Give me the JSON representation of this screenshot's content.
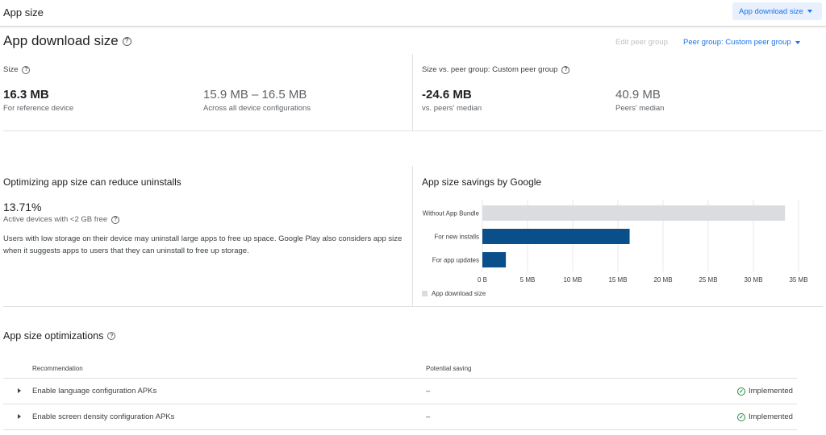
{
  "header": {
    "title": "App size",
    "dropdown_label": "App download size"
  },
  "download_size": {
    "title": "App download size",
    "edit_peer_group": "Edit peer group",
    "peer_group_dropdown": "Peer group: Custom peer group",
    "size": {
      "label": "Size",
      "reference_value": "16.3 MB",
      "reference_caption": "For reference device",
      "range_value": "15.9 MB – 16.5 MB",
      "range_caption": "Across all device configurations"
    },
    "peer": {
      "label": "Size vs. peer group: Custom peer group",
      "diff_value": "-24.6 MB",
      "diff_caption": "vs. peers' median",
      "median_value": "40.9 MB",
      "median_caption": "Peers' median"
    }
  },
  "optimizing": {
    "title": "Optimizing app size can reduce uninstalls",
    "percent": "13.71%",
    "percent_caption": "Active devices with <2 GB free",
    "description_line1": "Users with low storage on their device may uninstall large apps to free up space. Google Play also considers app size",
    "description_line2": "when it suggests apps to users that they can uninstall to free up storage."
  },
  "savings": {
    "title": "App size savings by Google"
  },
  "chart_data": {
    "type": "bar",
    "orientation": "horizontal",
    "categories": [
      "Without App Bundle",
      "For new installs",
      "For app updates"
    ],
    "values": [
      33.5,
      16.3,
      2.6
    ],
    "bar_colors": [
      "#dadce0",
      "#0b4f8a",
      "#0b4f8a"
    ],
    "x_ticks": [
      "0 B",
      "5 MB",
      "10 MB",
      "15 MB",
      "20 MB",
      "25 MB",
      "30 MB",
      "35 MB"
    ],
    "xlim": [
      0,
      35
    ],
    "unit": "MB",
    "legend": "App download size",
    "legend_position": "bottom-left",
    "grid": true
  },
  "optimizations": {
    "title": "App size optimizations",
    "columns": [
      "Recommendation",
      "Potential saving"
    ],
    "rows": [
      {
        "recommendation": "Enable language configuration APKs",
        "saving": "–",
        "status": "Implemented"
      },
      {
        "recommendation": "Enable screen density configuration APKs",
        "saving": "–",
        "status": "Implemented"
      }
    ]
  }
}
